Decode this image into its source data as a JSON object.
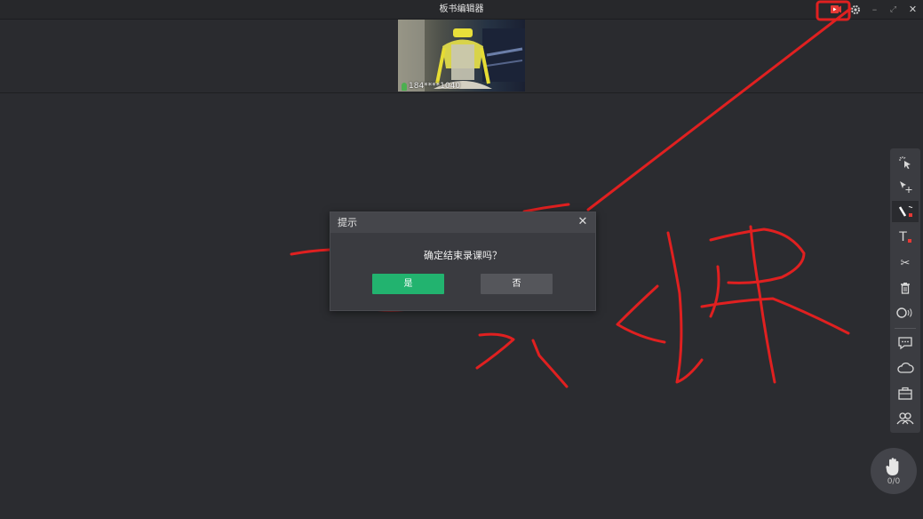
{
  "window": {
    "title": "板书编辑器",
    "controls": {
      "record_icon": "record-icon",
      "settings_icon": "gear-icon",
      "minimize": "–",
      "maximize": "⤢",
      "close": "✕"
    }
  },
  "video": {
    "participant_name": "184****1040",
    "mic_icon": "mic-icon"
  },
  "dialog": {
    "title": "提示",
    "close": "✕",
    "message": "确定结束录课吗？",
    "yes_label": "是",
    "no_label": "否"
  },
  "toolbar": {
    "tools": [
      {
        "name": "laser-pointer-icon"
      },
      {
        "name": "select-move-icon"
      },
      {
        "name": "pen-icon",
        "active": true
      },
      {
        "name": "text-icon",
        "glyph": "T"
      },
      {
        "name": "scissors-icon",
        "glyph": "✂"
      },
      {
        "name": "trash-icon"
      },
      {
        "name": "sound-wave-icon"
      },
      {
        "name": "chat-icon"
      },
      {
        "name": "cloud-icon"
      },
      {
        "name": "toolbox-icon"
      },
      {
        "name": "users-icon"
      }
    ]
  },
  "hand_raise": {
    "icon": "hand-icon",
    "count": "0/0"
  },
  "colors": {
    "background": "#2b2c30",
    "annotation_red": "#e02020",
    "confirm_green": "#22b36f",
    "record_red": "#e53935"
  }
}
